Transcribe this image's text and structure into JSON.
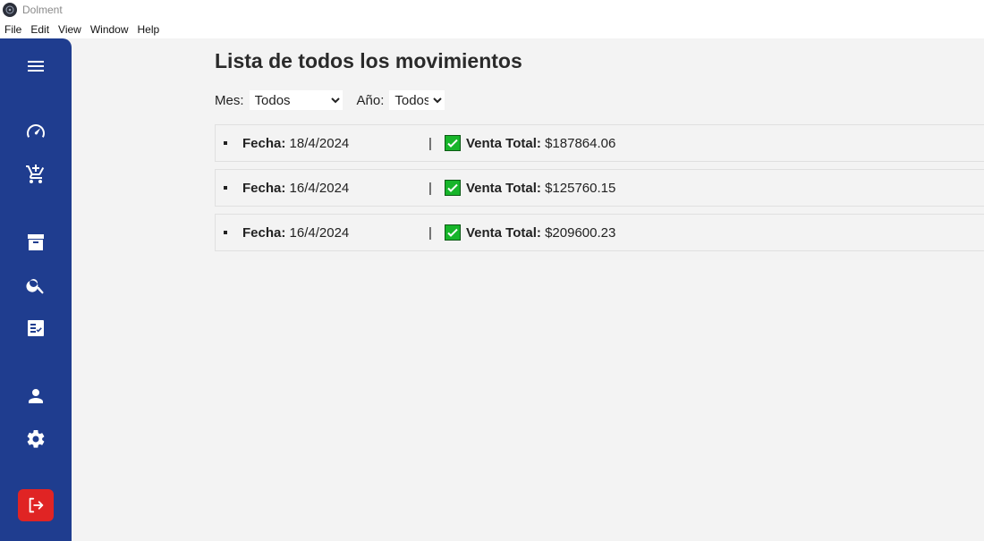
{
  "window": {
    "title": "Dolment"
  },
  "menu": [
    "File",
    "Edit",
    "View",
    "Window",
    "Help"
  ],
  "sidebar": {
    "icons": [
      "menu-icon",
      "dashboard-icon",
      "add-cart-icon",
      "archive-icon",
      "search-icon",
      "checklist-icon",
      "user-icon",
      "settings-icon",
      "logout-icon"
    ],
    "accent": "#1f3d8f",
    "logout_color": "#e02424"
  },
  "main": {
    "title": "Lista de todos los movimientos",
    "filters": {
      "mes_label": "Mes:",
      "mes_value": "Todos",
      "anio_label": "Año:",
      "anio_value": "Todos"
    },
    "fecha_label": "Fecha:",
    "venta_label": "Venta Total:",
    "separator": "|",
    "movimientos": [
      {
        "fecha": "18/4/2024",
        "venta": "$187864.06"
      },
      {
        "fecha": "16/4/2024",
        "venta": "$125760.15"
      },
      {
        "fecha": "16/4/2024",
        "venta": "$209600.23"
      }
    ],
    "check_color": "#17b52a"
  }
}
